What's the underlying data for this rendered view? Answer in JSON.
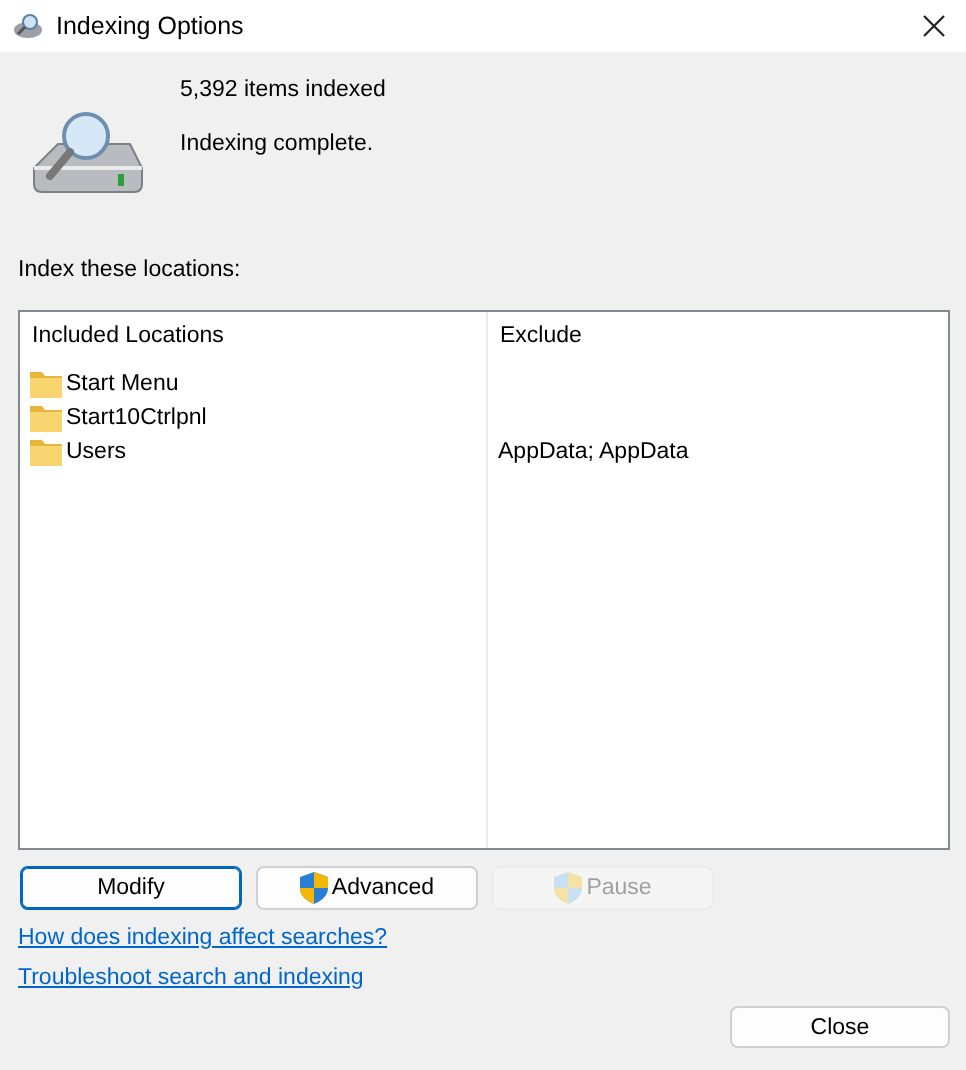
{
  "window": {
    "title": "Indexing Options"
  },
  "status": {
    "items_indexed": "5,392 items indexed",
    "message": "Indexing complete."
  },
  "locations_label": "Index these locations:",
  "table": {
    "columns": [
      "Included Locations",
      "Exclude"
    ],
    "rows": [
      {
        "location": "Start Menu",
        "exclude": ""
      },
      {
        "location": "Start10Ctrlpnl",
        "exclude": ""
      },
      {
        "location": "Users",
        "exclude": "AppData; AppData"
      }
    ]
  },
  "buttons": [
    {
      "label": "Modify",
      "shield": false,
      "disabled": false,
      "focused": true
    },
    {
      "label": "Advanced",
      "shield": true,
      "disabled": false,
      "focused": false
    },
    {
      "label": "Pause",
      "shield": true,
      "disabled": true,
      "focused": false
    }
  ],
  "links": [
    "How does indexing affect searches?",
    "Troubleshoot search and indexing"
  ],
  "close_button": "Close"
}
